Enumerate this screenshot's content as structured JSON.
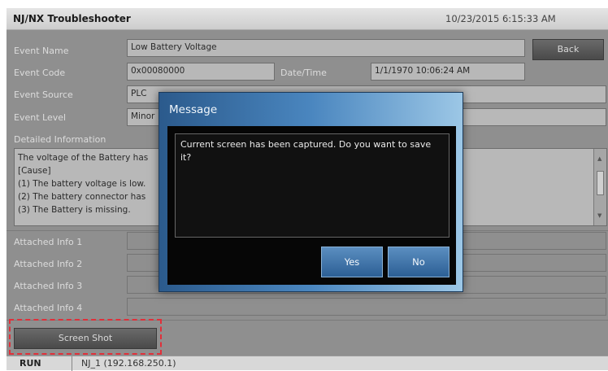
{
  "header": {
    "title": "NJ/NX Troubleshooter",
    "datetime": "10/23/2015 6:15:33 AM"
  },
  "event": {
    "name_label": "Event Name",
    "name_value": "Low Battery Voltage",
    "back_label": "Back",
    "code_label": "Event Code",
    "code_value": "0x00080000",
    "datetime_label": "Date/Time",
    "datetime_value": "1/1/1970 10:06:24 AM",
    "source_label": "Event Source",
    "source_value": "PLC",
    "level_label": "Event Level",
    "level_value": "Minor"
  },
  "detail": {
    "label": "Detailed Information",
    "lines": [
      "The voltage of the Battery has",
      "[Cause]",
      "(1) The battery voltage is low.",
      "(2) The battery connector has",
      "(3) The Battery is missing."
    ]
  },
  "attached": [
    {
      "label": "Attached Info 1",
      "value": ""
    },
    {
      "label": "Attached Info 2",
      "value": ""
    },
    {
      "label": "Attached Info 3",
      "value": ""
    },
    {
      "label": "Attached Info 4",
      "value": ""
    }
  ],
  "screenshot_label": "Screen Shot",
  "status": {
    "mode": "RUN",
    "node": "NJ_1 (192.168.250.1)"
  },
  "modal": {
    "title": "Message",
    "message": "Current screen has been captured. Do you want to save it?",
    "yes_label": "Yes",
    "no_label": "No"
  },
  "colors": {
    "highlight": "#e0303a",
    "modal_accent": "#4a86bf"
  }
}
